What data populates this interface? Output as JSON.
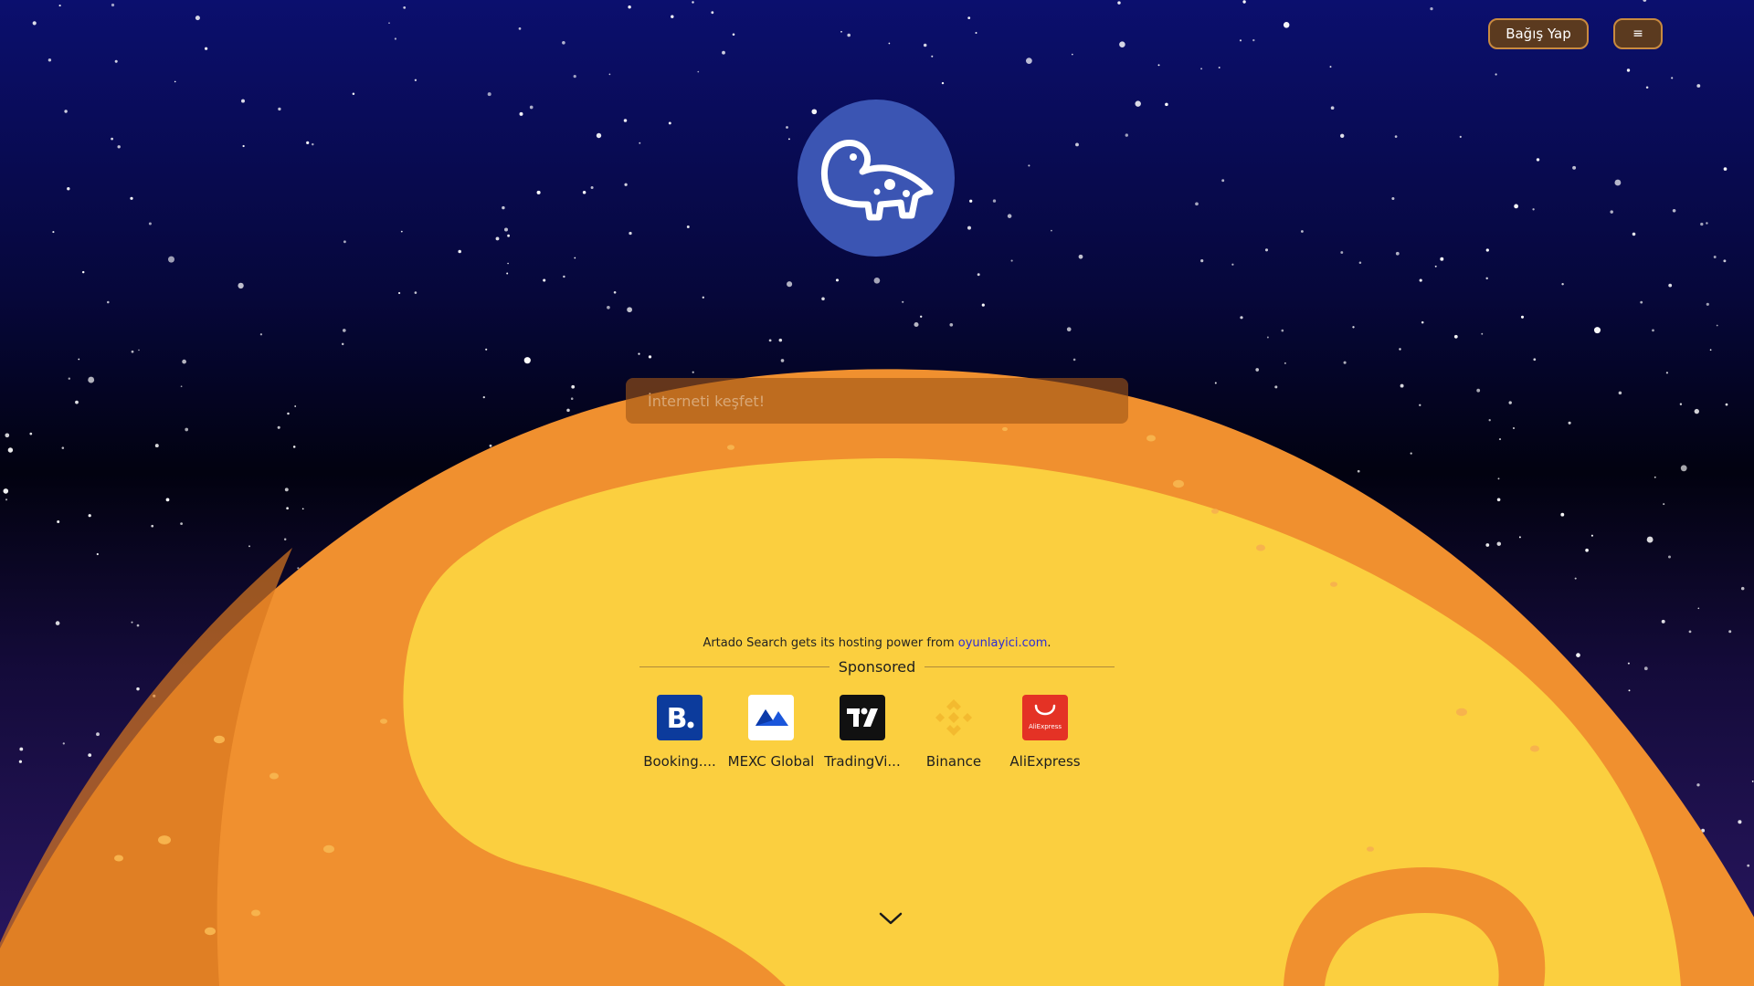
{
  "header": {
    "donate_label": "Bağış Yap",
    "menu_label": "≡"
  },
  "search": {
    "placeholder": "İnterneti keşfet!"
  },
  "hosting": {
    "prefix": "Artado Search gets its hosting power from ",
    "link_text": "oyunlayici.com",
    "suffix": "."
  },
  "sponsored": {
    "label": "Sponsored",
    "items": [
      {
        "name": "Booking....",
        "icon": "booking-icon",
        "tile_color": "#0c3b9c"
      },
      {
        "name": "MEXC Global",
        "icon": "mexc-icon",
        "tile_color": "#ffffff"
      },
      {
        "name": "TradingVi...",
        "icon": "tradingview-icon",
        "tile_color": "#111111"
      },
      {
        "name": "Binance",
        "icon": "binance-icon",
        "tile_color": "#f3ba2f"
      },
      {
        "name": "AliExpress",
        "icon": "aliexpress-icon",
        "tile_color": "#e43225",
        "tile_text": "AliExpress"
      }
    ]
  },
  "colors": {
    "sky_top": "#0b0f6e",
    "planet_outer": "#f0902f",
    "planet_inner": "#fbcf3f",
    "logo_bg": "#3b55b3"
  }
}
